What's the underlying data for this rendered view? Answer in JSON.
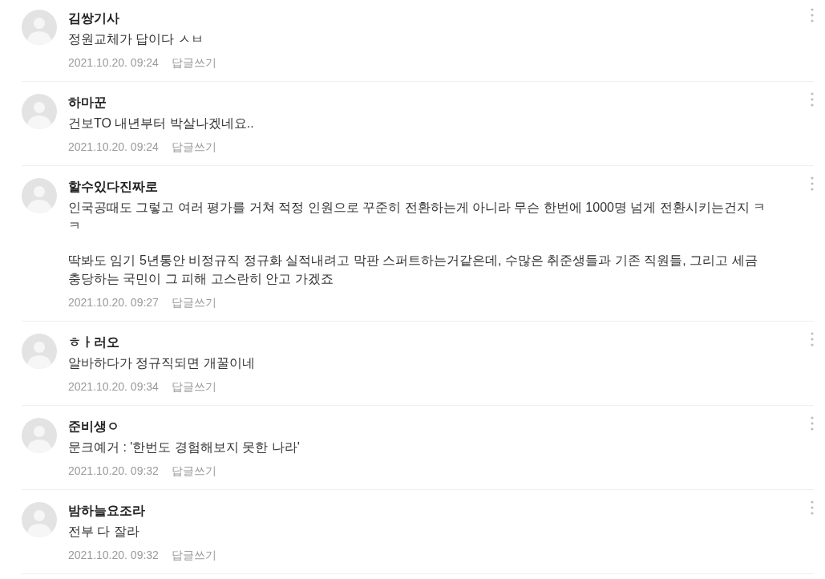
{
  "comments": [
    {
      "author": "김쌍기사",
      "body": [
        "정원교체가 답이다 ㅅㅂ"
      ],
      "date": "2021.10.20. 09:24",
      "reply_label": "답글쓰기"
    },
    {
      "author": "하마꾼",
      "body": [
        "건보TO 내년부터 박살나겠네요.."
      ],
      "date": "2021.10.20. 09:24",
      "reply_label": "답글쓰기"
    },
    {
      "author": "할수있다진짜로",
      "body": [
        "인국공때도 그렇고 여러 평가를 거쳐 적정 인원으로 꾸준히 전환하는게 아니라 무슨 한번에 1000명 넘게 전환시키는건지 ㅋㅋ",
        "딱봐도 임기 5년통안 비정규직 정규화 실적내려고 막판 스퍼트하는거같은데, 수많은 취준생들과 기존 직원들, 그리고 세금 충당하는 국민이 그 피해 고스란히 안고 가겠죠"
      ],
      "date": "2021.10.20. 09:27",
      "reply_label": "답글쓰기"
    },
    {
      "author": "ㅎㅏ러오",
      "body": [
        "알바하다가 정규직되면 개꿀이네"
      ],
      "date": "2021.10.20. 09:34",
      "reply_label": "답글쓰기"
    },
    {
      "author": "준비생ㅇ",
      "body": [
        "문크예거 : '한번도 경험해보지 못한 나라'"
      ],
      "date": "2021.10.20. 09:32",
      "reply_label": "답글쓰기"
    },
    {
      "author": "밤하늘요조라",
      "body": [
        "전부 다 잘라"
      ],
      "date": "2021.10.20. 09:32",
      "reply_label": "답글쓰기"
    }
  ]
}
